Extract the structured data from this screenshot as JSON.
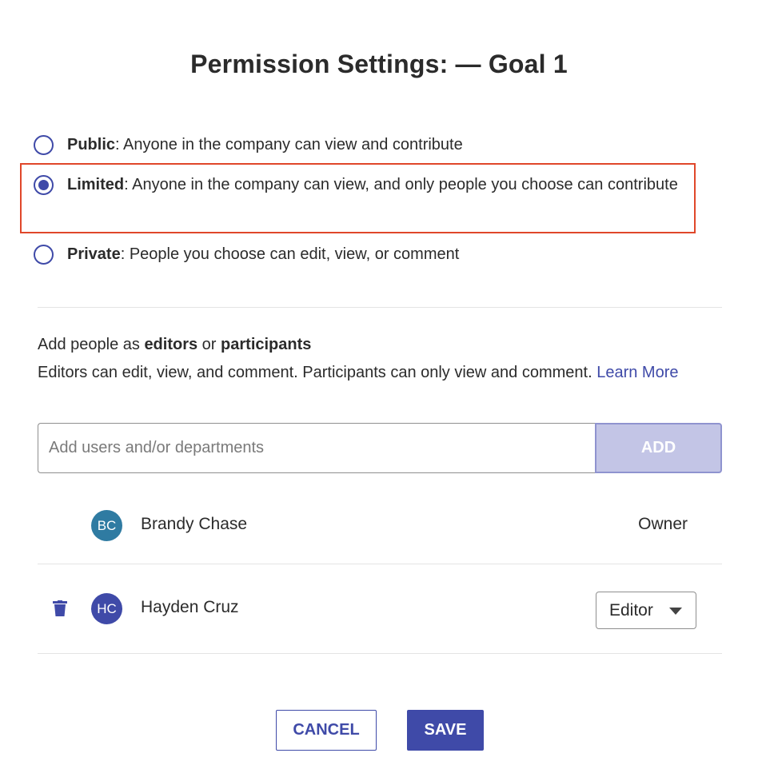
{
  "dialog": {
    "title": "Permission Settings: — Goal 1"
  },
  "permissions": {
    "options": [
      {
        "label": "Public",
        "description": ": Anyone in the company can view and contribute",
        "selected": false
      },
      {
        "label": "Limited",
        "description": ": Anyone in the company can view, and only people you choose can contribute",
        "selected": true
      },
      {
        "label": "Private",
        "description": ": People you choose can edit, view, or comment",
        "selected": false
      }
    ]
  },
  "people_section": {
    "heading_prefix": "Add people as ",
    "heading_editors": "editors",
    "heading_or": " or ",
    "heading_participants": "participants",
    "description": "Editors can edit, view, and comment. Participants can only view and comment. ",
    "learn_more": "Learn More"
  },
  "search": {
    "placeholder": "Add users and/or departments",
    "value": "",
    "add_label": "ADD"
  },
  "people": [
    {
      "initials": "BC",
      "name": "Brandy Chase",
      "role": "Owner",
      "avatar_color": "#2f7ba2"
    },
    {
      "initials": "HC",
      "name": "Hayden Cruz",
      "role": "Editor",
      "avatar_color": "#3f4aa8"
    }
  ],
  "icons": {
    "delete": "trash-icon",
    "dropdown": "chevron-down-icon"
  },
  "actions": {
    "cancel_label": "CANCEL",
    "save_label": "SAVE"
  },
  "colors": {
    "accent": "#3f4aa8",
    "highlight": "#e0472a",
    "add_disabled": "#c3c5e6"
  }
}
